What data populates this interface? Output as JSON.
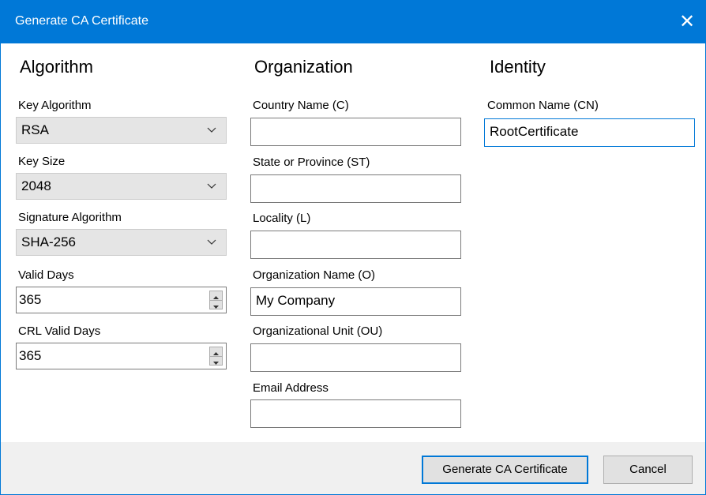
{
  "window": {
    "title": "Generate CA Certificate",
    "close_glyph": "✕"
  },
  "algorithm": {
    "heading": "Algorithm",
    "key_algorithm": {
      "label": "Key Algorithm",
      "value": "RSA"
    },
    "key_size": {
      "label": "Key Size",
      "value": "2048"
    },
    "signature_algorithm": {
      "label": "Signature Algorithm",
      "value": "SHA-256"
    },
    "valid_days": {
      "label": "Valid Days",
      "value": "365"
    },
    "crl_valid_days": {
      "label": "CRL Valid Days",
      "value": "365"
    }
  },
  "organization": {
    "heading": "Organization",
    "country": {
      "label": "Country Name (C)",
      "value": ""
    },
    "state": {
      "label": "State or Province (ST)",
      "value": ""
    },
    "locality": {
      "label": "Locality (L)",
      "value": ""
    },
    "org_name": {
      "label": "Organization Name (O)",
      "value": "My Company"
    },
    "org_unit": {
      "label": "Organizational Unit (OU)",
      "value": ""
    },
    "email": {
      "label": "Email Address",
      "value": ""
    }
  },
  "identity": {
    "heading": "Identity",
    "common_name": {
      "label": "Common Name (CN)",
      "value": "RootCertificate"
    }
  },
  "footer": {
    "generate_label": "Generate CA Certificate",
    "cancel_label": "Cancel"
  },
  "colors": {
    "accent": "#0078d7",
    "footer_bg": "#f0f0f0",
    "combo_bg": "#e5e5e5"
  }
}
